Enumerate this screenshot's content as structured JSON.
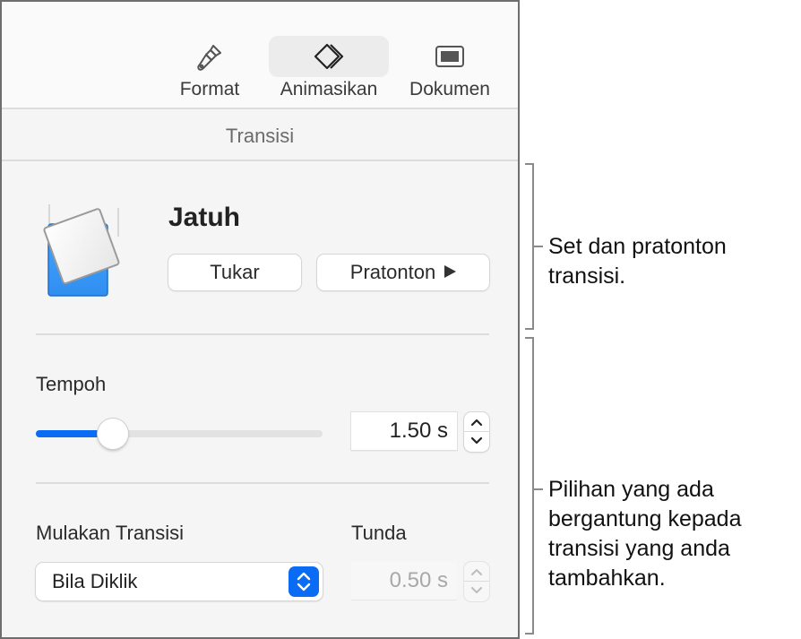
{
  "toolbar": {
    "items": [
      {
        "label": "Format",
        "icon": "paintbrush-icon",
        "active": false
      },
      {
        "label": "Animasikan",
        "icon": "animate-diamonds-icon",
        "active": true
      },
      {
        "label": "Dokumen",
        "icon": "document-icon",
        "active": false
      }
    ]
  },
  "section": {
    "title": "Transisi"
  },
  "transition": {
    "name": "Jatuh",
    "change_label": "Tukar",
    "preview_label": "Pratonton",
    "thumbnail_color": "#3b9cf7"
  },
  "duration": {
    "label": "Tempoh",
    "value": "1.50 s",
    "slider_fraction": 0.27,
    "accent_color": "#0a6cf5"
  },
  "start": {
    "label": "Mulakan Transisi",
    "selected": "Bila Diklik"
  },
  "delay": {
    "label": "Tunda",
    "value": "0.50 s",
    "disabled": true
  },
  "callouts": [
    {
      "text_lines": [
        "Set dan pratonton",
        "transisi."
      ]
    },
    {
      "text_lines": [
        "Pilihan yang ada",
        "bergantung kepada",
        "transisi yang anda",
        "tambahkan."
      ]
    }
  ]
}
